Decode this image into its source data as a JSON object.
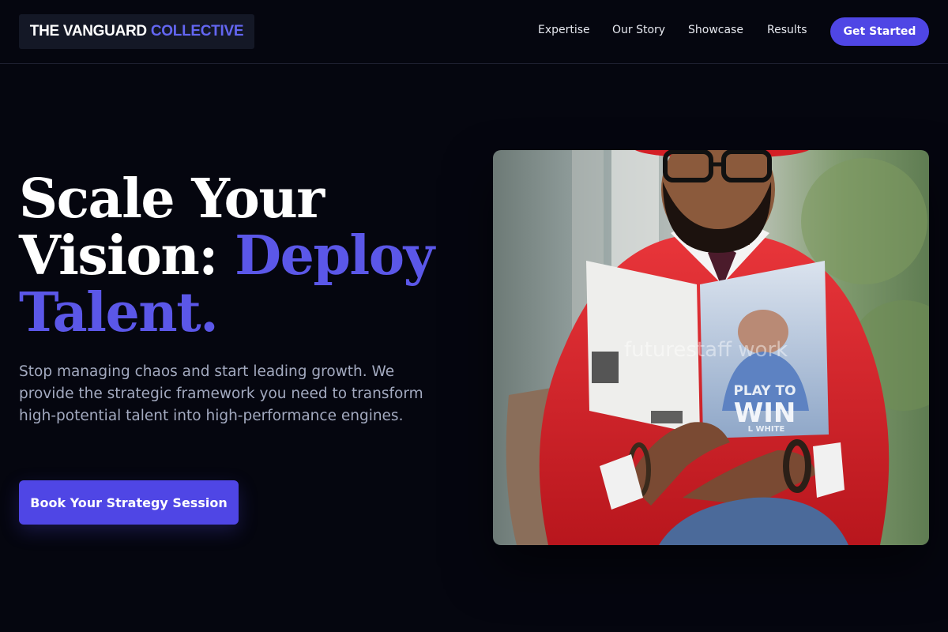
{
  "header": {
    "logo": {
      "primary": "THE VANGUARD",
      "accent": "COLLECTIVE"
    },
    "nav": [
      {
        "label": "Expertise"
      },
      {
        "label": "Our Story"
      },
      {
        "label": "Showcase"
      },
      {
        "label": "Results"
      }
    ],
    "cta_label": "Get Started"
  },
  "hero": {
    "headline_line1": "Scale Your",
    "headline_line2_plain": "Vision:",
    "headline_line2_accent": "Deploy",
    "headline_line3_accent": "Talent.",
    "subtext": "Stop managing chaos and start leading growth. We provide the strategic framework you need to transform high-potential talent into high-performance engines.",
    "cta_label": "Book Your Strategy Session",
    "image": {
      "alt": "Man in red jacket reading a book",
      "watermark": "futurestaff work",
      "book_title_line1": "PLAY TO",
      "book_title_line2": "WIN",
      "book_author": "L WHITE"
    }
  },
  "colors": {
    "background": "#05060f",
    "accent": "#4f46e5",
    "headline_accent": "#5b57e8",
    "subtext": "#a3aac0"
  }
}
